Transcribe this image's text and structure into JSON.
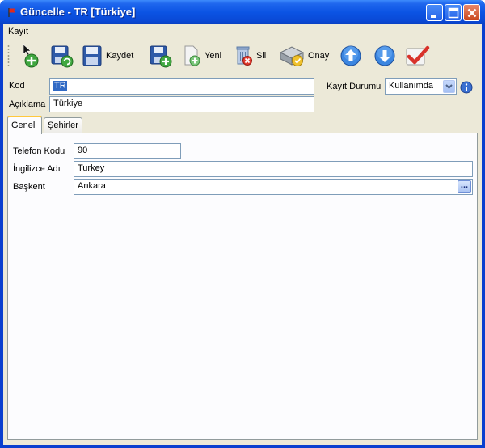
{
  "window": {
    "title": "Güncelle - TR [Türkiye]"
  },
  "menu": {
    "items": [
      "Kayıt"
    ]
  },
  "toolbar": {
    "save_label": "Kaydet",
    "new_label": "Yeni",
    "delete_label": "Sil",
    "approve_label": "Onay"
  },
  "form": {
    "code_label": "Kod",
    "code_value": "TR",
    "description_label": "Açıklama",
    "description_value": "Türkiye",
    "status_label": "Kayıt Durumu",
    "status_value": "Kullanımda"
  },
  "tabs": [
    {
      "label": "Genel",
      "active": true
    },
    {
      "label": "Şehirler",
      "active": false
    }
  ],
  "general": {
    "phone_label": "Telefon Kodu",
    "phone_value": "90",
    "english_label": "İngilizce Adı",
    "english_value": "Turkey",
    "capital_label": "Başkent",
    "capital_value": "Ankara",
    "capital_button": "..."
  },
  "colors": {
    "titlebar": "#0b54e4",
    "client": "#ece9d8",
    "selection": "#316ac5",
    "active_tab_accent": "#ffc83c"
  },
  "icons": {
    "title": "flag-icon",
    "window_buttons": [
      "minimize-icon",
      "maximize-icon",
      "close-icon"
    ],
    "toolbar": [
      "new-record-icon",
      "save-refresh-icon",
      "save-icon",
      "save-new-icon",
      "new-icon",
      "delete-icon",
      "approve-icon",
      "up-arrow-icon",
      "down-arrow-icon",
      "check-icon"
    ],
    "status_info": "info-icon"
  }
}
